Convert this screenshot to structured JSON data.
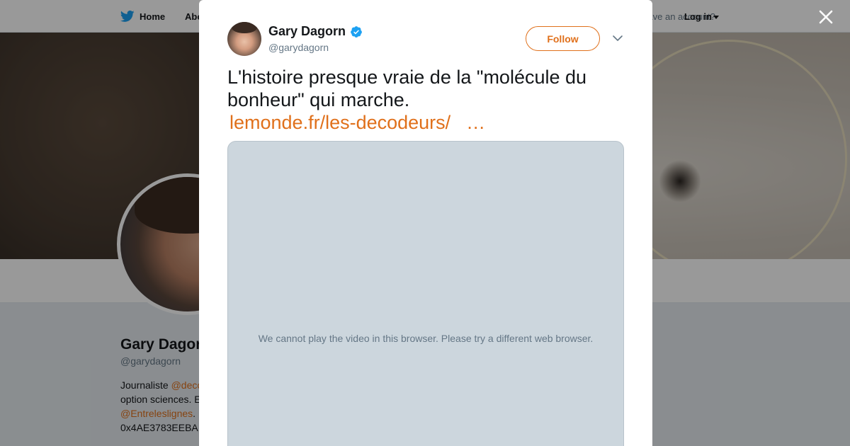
{
  "nav": {
    "home_label": "Home",
    "about_label": "Abo",
    "account_prompt": "Have an account?",
    "login_label": "Log in"
  },
  "profile": {
    "name": "Gary Dagorn",
    "handle": "@garydagorn",
    "bio_prefix": "Journaliste ",
    "bio_link1": "@deco",
    "bio_line2": "option sciences. E",
    "bio_link2": "@Entreleslignes",
    "bio_line4": "0x4AE3783EEBA"
  },
  "tweet": {
    "author_name": "Gary Dagorn",
    "author_handle": "@garydagorn",
    "verified": true,
    "follow_label": "Follow",
    "text": "L'histoire presque vraie de la \"molécule du bonheur\" qui marche.",
    "link_text": "lemonde.fr/les-decodeurs/",
    "link_ellipsis": "…",
    "video_message": "We cannot play the video in this browser. Please try a different web browser."
  },
  "colors": {
    "accent": "#e0701b",
    "twitter_blue": "#1da1f2",
    "video_bg": "#ccd6dd"
  },
  "icons": {
    "close": "close-icon",
    "chevron": "chevron-down-icon",
    "verified": "verified-badge-icon",
    "bird": "twitter-bird-icon"
  }
}
